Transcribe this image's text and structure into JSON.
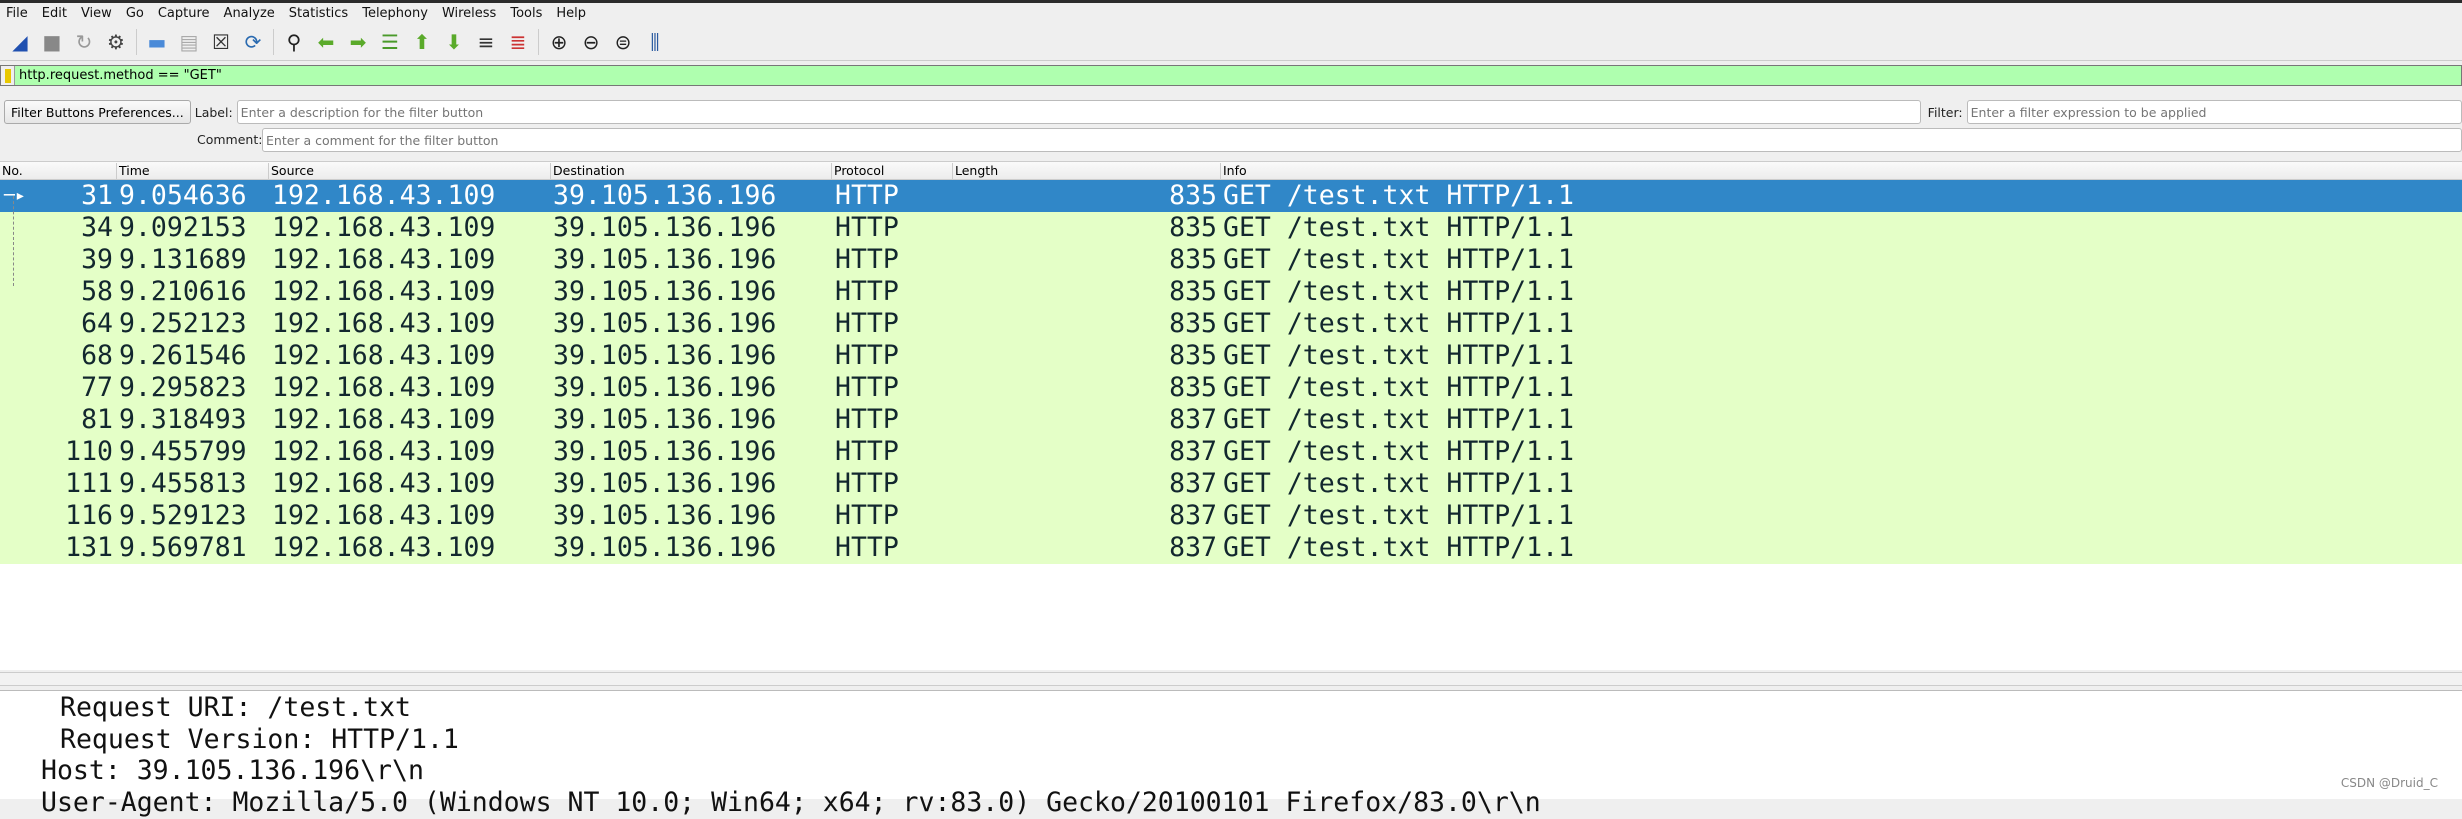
{
  "menu": [
    "File",
    "Edit",
    "View",
    "Go",
    "Capture",
    "Analyze",
    "Statistics",
    "Telephony",
    "Wireless",
    "Tools",
    "Help"
  ],
  "toolbar_icons": [
    "shark-fin-start-icon",
    "stop-icon",
    "restart-icon",
    "options-gear-icon",
    "open-folder-icon",
    "save-file-icon",
    "close-file-icon",
    "reload-icon",
    "find-icon",
    "back-arrow-icon",
    "forward-arrow-icon",
    "go-to-packet-icon",
    "first-packet-icon",
    "last-packet-icon",
    "autoscroll-icon",
    "colorize-icon",
    "zoom-in-icon",
    "zoom-out-icon",
    "zoom-normal-icon",
    "resize-columns-icon"
  ],
  "display_filter": {
    "value": "http.request.method == \"GET\""
  },
  "filter_buttons": {
    "prefs_label": "Filter Buttons Preferences...",
    "label_label": "Label:",
    "label_placeholder": "Enter a description for the filter button",
    "filter_label": "Filter:",
    "filter_placeholder": "Enter a filter expression to be applied",
    "comment_label": "Comment:",
    "comment_placeholder": "Enter a comment for the filter button"
  },
  "columns": [
    "No.",
    "Time",
    "Source",
    "Destination",
    "Protocol",
    "Length",
    "Info"
  ],
  "packets": [
    {
      "no": "31",
      "time": "9.054636",
      "src": "192.168.43.109",
      "dst": "39.105.136.196",
      "proto": "HTTP",
      "len": "835",
      "info": "GET /test.txt HTTP/1.1"
    },
    {
      "no": "34",
      "time": "9.092153",
      "src": "192.168.43.109",
      "dst": "39.105.136.196",
      "proto": "HTTP",
      "len": "835",
      "info": "GET /test.txt HTTP/1.1"
    },
    {
      "no": "39",
      "time": "9.131689",
      "src": "192.168.43.109",
      "dst": "39.105.136.196",
      "proto": "HTTP",
      "len": "835",
      "info": "GET /test.txt HTTP/1.1"
    },
    {
      "no": "58",
      "time": "9.210616",
      "src": "192.168.43.109",
      "dst": "39.105.136.196",
      "proto": "HTTP",
      "len": "835",
      "info": "GET /test.txt HTTP/1.1"
    },
    {
      "no": "64",
      "time": "9.252123",
      "src": "192.168.43.109",
      "dst": "39.105.136.196",
      "proto": "HTTP",
      "len": "835",
      "info": "GET /test.txt HTTP/1.1"
    },
    {
      "no": "68",
      "time": "9.261546",
      "src": "192.168.43.109",
      "dst": "39.105.136.196",
      "proto": "HTTP",
      "len": "835",
      "info": "GET /test.txt HTTP/1.1"
    },
    {
      "no": "77",
      "time": "9.295823",
      "src": "192.168.43.109",
      "dst": "39.105.136.196",
      "proto": "HTTP",
      "len": "835",
      "info": "GET /test.txt HTTP/1.1"
    },
    {
      "no": "81",
      "time": "9.318493",
      "src": "192.168.43.109",
      "dst": "39.105.136.196",
      "proto": "HTTP",
      "len": "837",
      "info": "GET /test.txt HTTP/1.1"
    },
    {
      "no": "110",
      "time": "9.455799",
      "src": "192.168.43.109",
      "dst": "39.105.136.196",
      "proto": "HTTP",
      "len": "837",
      "info": "GET /test.txt HTTP/1.1"
    },
    {
      "no": "111",
      "time": "9.455813",
      "src": "192.168.43.109",
      "dst": "39.105.136.196",
      "proto": "HTTP",
      "len": "837",
      "info": "GET /test.txt HTTP/1.1"
    },
    {
      "no": "116",
      "time": "9.529123",
      "src": "192.168.43.109",
      "dst": "39.105.136.196",
      "proto": "HTTP",
      "len": "837",
      "info": "GET /test.txt HTTP/1.1"
    },
    {
      "no": "131",
      "time": "9.569781",
      "src": "192.168.43.109",
      "dst": "39.105.136.196",
      "proto": "HTTP",
      "len": "837",
      "info": "GET /test.txt HTTP/1.1"
    }
  ],
  "selected_index": 0,
  "details": [
    {
      "indent": 2,
      "text": "Request URI: /test.txt"
    },
    {
      "indent": 2,
      "text": "Request Version: HTTP/1.1"
    },
    {
      "indent": 1,
      "text": "Host: 39.105.136.196\\r\\n"
    },
    {
      "indent": 1,
      "text": "User-Agent: Mozilla/5.0 (Windows NT 10.0; Win64; x64; rv:83.0) Gecko/20100101 Firefox/83.0\\r\\n"
    }
  ],
  "watermark": "CSDN @Druid_C",
  "colors": {
    "selected_row": "#3087c8",
    "http_row": "#e4ffc7",
    "filter_valid": "#afffaf"
  }
}
